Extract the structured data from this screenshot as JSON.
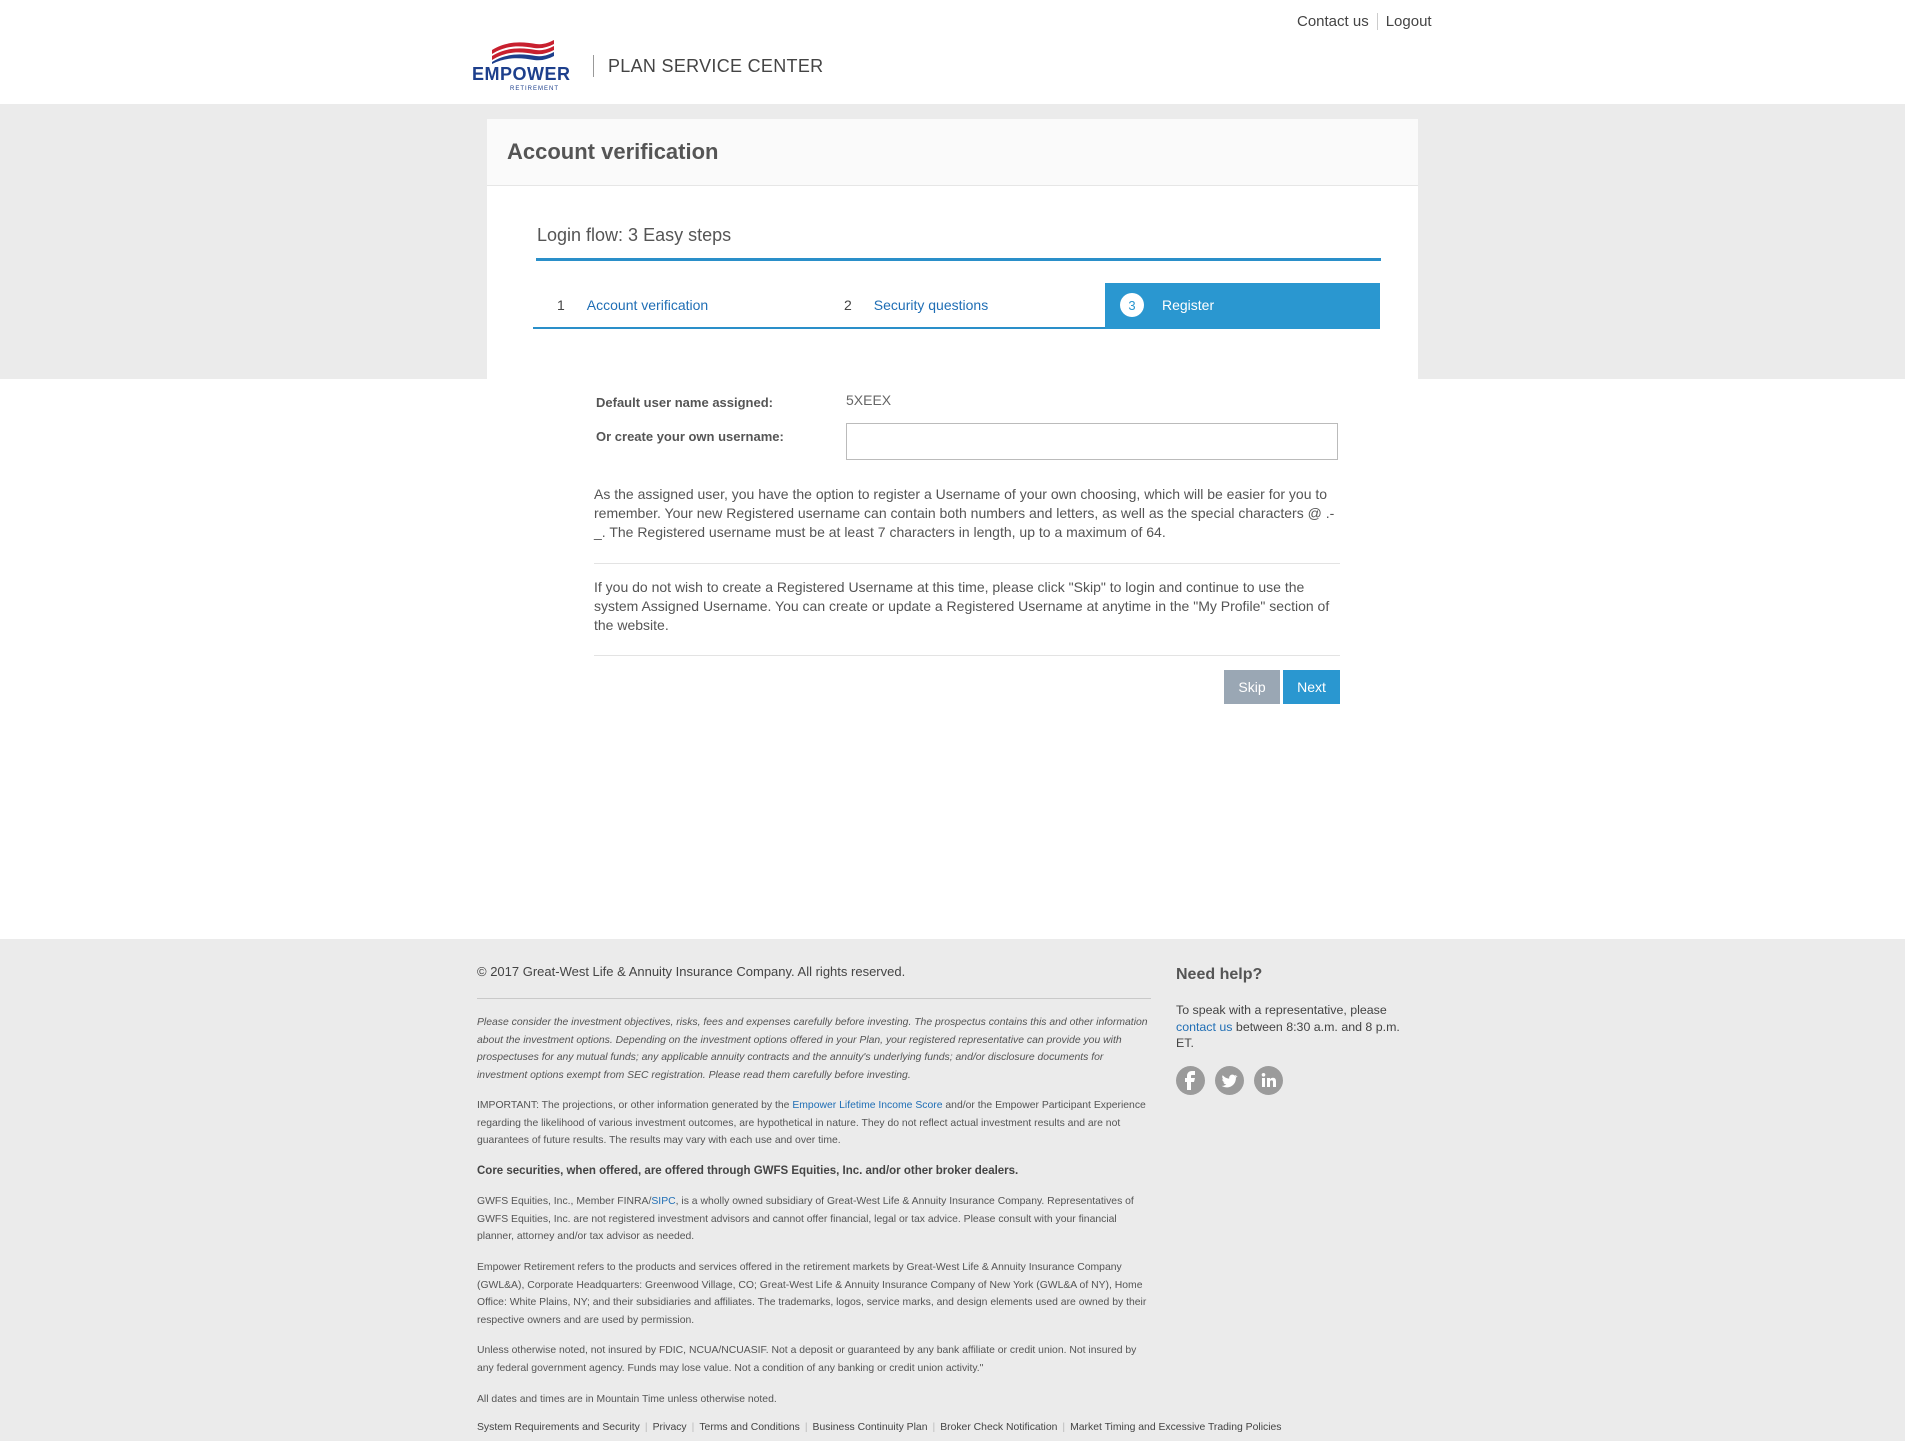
{
  "header": {
    "contact_us": "Contact us",
    "logout": "Logout",
    "logo_word": "EMPOWER",
    "logo_sub": "RETIREMENT",
    "brand_title": "PLAN SERVICE CENTER"
  },
  "card": {
    "title": "Account verification",
    "flow_title": "Login flow: 3 Easy steps"
  },
  "steps": [
    {
      "num": "1",
      "label": "Account verification"
    },
    {
      "num": "2",
      "label": "Security questions"
    },
    {
      "num": "3",
      "label": "Register"
    }
  ],
  "form": {
    "default_label": "Default user name assigned:",
    "default_value": "5XEEX",
    "create_label": "Or create your own username:",
    "create_value": "",
    "para1": "As the assigned user, you have the option to register a Username of your own choosing, which will be easier for you to remember. Your new Registered username can contain both numbers and letters, as well as the special characters @ .-_. The Registered username must be at least 7 characters in length, up to a maximum of 64.",
    "para2": "If you do not wish to create a Registered Username at this time, please click \"Skip\" to login and continue to use the system Assigned Username. You can create or update a Registered Username at anytime in the \"My Profile\" section of the website.",
    "skip": "Skip",
    "next": "Next"
  },
  "footer": {
    "copyright": "© 2017 Great-West Life & Annuity Insurance Company. All rights reserved.",
    "disclaimer": "Please consider the investment objectives, risks, fees and expenses carefully before investing. The prospectus contains this and other information about the investment options. Depending on the investment options offered in your Plan, your registered representative can provide you with prospectuses for any mutual funds; any applicable annuity contracts and the annuity's underlying funds; and/or disclosure documents for investment options exempt from SEC registration. Please read them carefully before investing.",
    "important_pre": "IMPORTANT: The projections, or other information generated by the ",
    "important_link": "Empower Lifetime Income Score",
    "important_post": " and/or the Empower Participant Experience regarding the likelihood of various investment outcomes, are hypothetical in nature. They do not reflect actual investment results and are not guarantees of future results. The results may vary with each use and over time.",
    "core": "Core securities, when offered, are offered through GWFS Equities, Inc. and/or other broker dealers.",
    "gwfs_pre": "GWFS Equities, Inc., Member FINRA/",
    "gwfs_link": "SIPC",
    "gwfs_post": ", is a wholly owned subsidiary of Great-West Life & Annuity Insurance Company. Representatives of GWFS Equities, Inc. are not registered investment advisors and cannot offer financial, legal or tax advice. Please consult with your financial planner, attorney and/or tax advisor as needed.",
    "empower": "Empower Retirement refers to the products and services offered in the retirement markets by Great-West Life & Annuity Insurance Company (GWL&A), Corporate Headquarters: Greenwood Village, CO; Great-West Life & Annuity Insurance Company of New York (GWL&A of NY), Home Office: White Plains, NY; and their subsidiaries and affiliates. The trademarks, logos, service marks, and design elements used are owned by their respective owners and are used by permission.",
    "fdic": "Unless otherwise noted, not insured by FDIC, NCUA/NCUASIF. Not a deposit or guaranteed by any bank affiliate or credit union. Not insured by any federal government agency. Funds may lose value. Not a condition of any banking or credit union activity.\"",
    "times": "All dates and times are in Mountain Time unless otherwise noted.",
    "links": [
      "System Requirements and Security",
      "Privacy",
      "Terms and Conditions",
      "Business Continuity Plan",
      "Broker Check Notification",
      "Market Timing and Excessive Trading Policies"
    ],
    "help_title": "Need help?",
    "help_pre": "To speak with a representative, please",
    "help_link": "contact us",
    "help_post": " between 8:30 a.m. and 8 p.m. ET.",
    "social_icons": [
      "facebook-icon",
      "twitter-icon",
      "linkedin-icon"
    ]
  },
  "colors": {
    "accent": "#2a97d0",
    "link": "#1f6eb5",
    "skip_button": "#9aa7b4",
    "band": "#ebebeb",
    "logo_blue": "#1d3f8c",
    "logo_red": "#c8202f"
  }
}
